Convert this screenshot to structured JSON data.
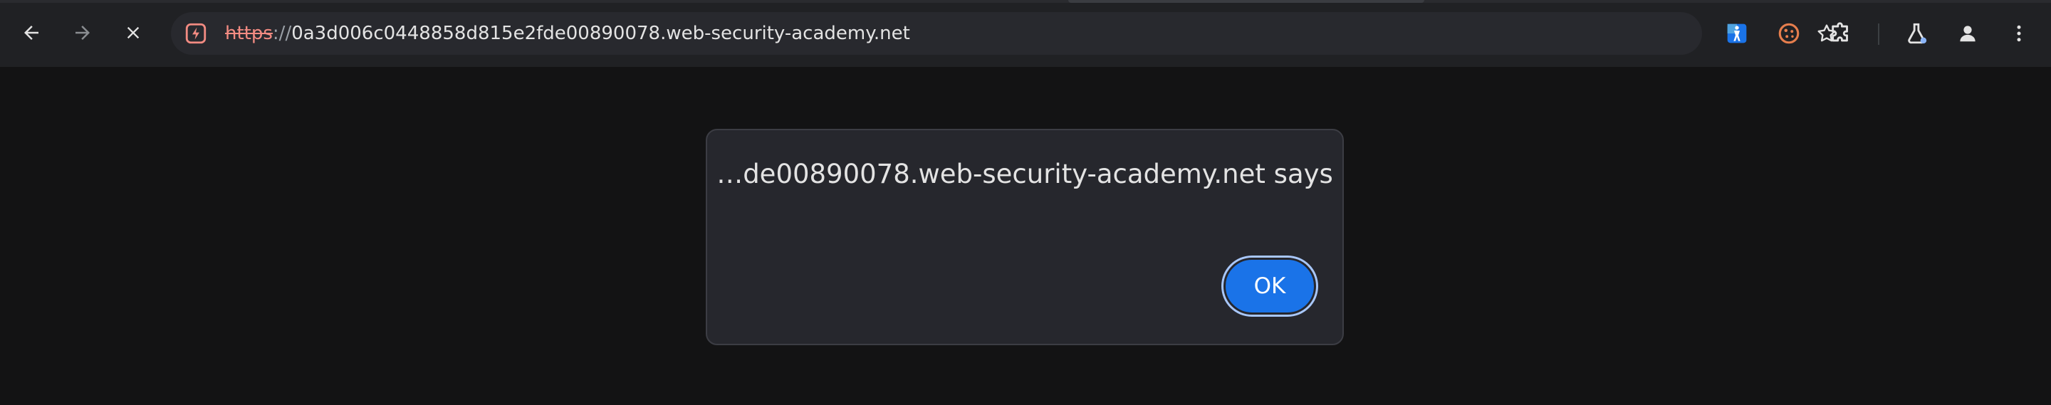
{
  "browser": {
    "nav": {
      "back_icon": "arrow-left-icon",
      "forward_icon": "arrow-right-icon",
      "stop_icon": "close-icon"
    },
    "omnibox": {
      "security_icon": "not-secure-warning-icon",
      "url_scheme": "https",
      "url_separator": "://",
      "url_host": "0a3d006c0448858d815e2fde00890078.web-security-academy.net",
      "bookmark_icon": "star-icon"
    },
    "extensions": [
      {
        "name": "accessibility-extension-icon"
      },
      {
        "name": "cookie-extension-icon"
      },
      {
        "name": "puzzle-extensions-icon"
      },
      {
        "name": "labs-flask-icon"
      },
      {
        "name": "profile-avatar-icon"
      },
      {
        "name": "kebab-menu-icon"
      }
    ],
    "colors": {
      "toolbar_bg": "#202124",
      "omnibox_bg": "#28292e",
      "content_bg": "#131314",
      "warning": "#f28b82",
      "accent": "#1a73e8"
    }
  },
  "dialog": {
    "title": "…de00890078.web-security-academy.net says",
    "ok_label": "OK"
  }
}
